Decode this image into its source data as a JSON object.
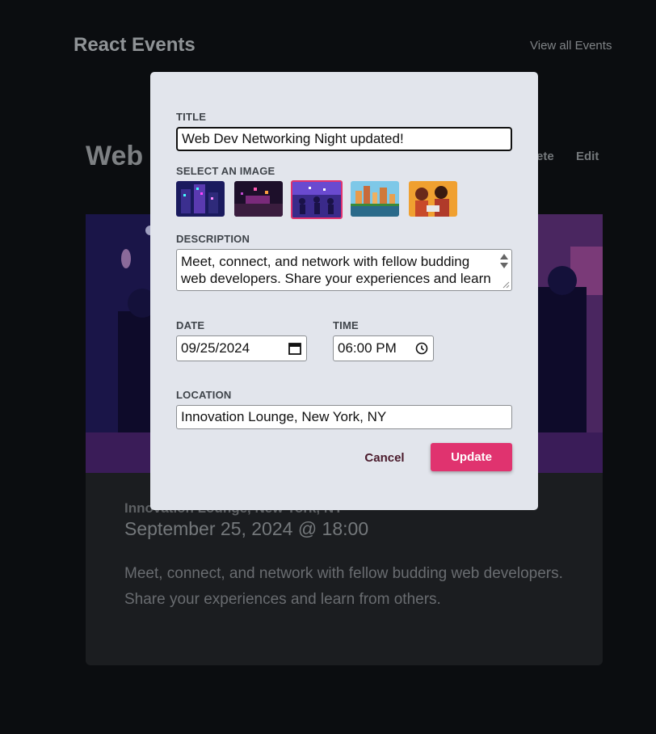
{
  "header": {
    "title": "React Events",
    "view_all": "View all Events"
  },
  "event": {
    "title_partial": "Web I",
    "actions": {
      "delete": "ete",
      "edit": "Edit"
    },
    "location": "Innovation Lounge, New York, NY",
    "date_time": "September 25, 2024 @ 18:00",
    "description": "Meet, connect, and network with fellow budding web developers. Share your experiences and learn from others."
  },
  "modal": {
    "title_label": "TITLE",
    "title_value": "Web Dev Networking Night updated!",
    "image_label": "SELECT AN IMAGE",
    "images": [
      {
        "name": "isometric-city"
      },
      {
        "name": "club-stage"
      },
      {
        "name": "networking-night",
        "selected": true
      },
      {
        "name": "waterfront-skyline"
      },
      {
        "name": "coworkers-laptop"
      }
    ],
    "description_label": "DESCRIPTION",
    "description_value": "Meet, connect, and network with fellow budding web developers. Share your experiences and learn",
    "date_label": "DATE",
    "date_value": "09/25/2024",
    "time_label": "TIME",
    "time_value": "06:00 PM",
    "location_label": "LOCATION",
    "location_value": "Innovation Lounge, New York, NY",
    "cancel_label": "Cancel",
    "update_label": "Update"
  },
  "colors": {
    "accent": "#e0336f",
    "modal_bg": "#e2e5ec",
    "page_bg": "#0b0d10"
  }
}
